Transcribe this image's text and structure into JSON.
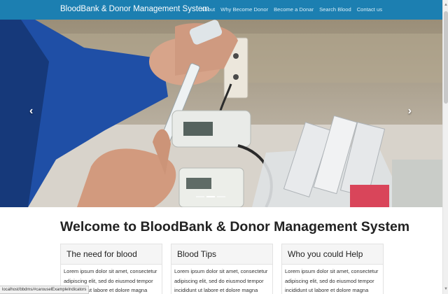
{
  "navbar": {
    "brand": "BloodBank & Donor Management System",
    "links": [
      "About",
      "Why Become Donor",
      "Become a Donar",
      "Search Blood",
      "Contact us"
    ]
  },
  "carousel": {
    "prev_icon": "chevron-left",
    "next_icon": "chevron-right",
    "slide_count": 3,
    "active_slide": 2
  },
  "main": {
    "welcome_title": "Welcome to BloodBank & Donor Management System",
    "cards": [
      {
        "title": "The need for blood",
        "text": "Lorem ipsum dolor sit amet, consectetur adipiscing elit, sed do eiusmod tempor incididunt ut labore et dolore magna aliqua."
      },
      {
        "title": "Blood Tips",
        "text": "Lorem ipsum dolor sit amet, consectetur adipiscing elit, sed do eiusmod tempor incididunt ut labore et dolore magna aliqua."
      },
      {
        "title": "Who you could Help",
        "text": "Lorem ipsum dolor sit amet, consectetur adipiscing elit, sed do eiusmod tempor incididunt ut labore et dolore magna aliqua."
      }
    ]
  },
  "status_bar": {
    "url": "localhost/bbdms/#carouselExampleIndicators"
  },
  "colors": {
    "navbar": "#1c7fb1",
    "card_header": "#f5f5f5",
    "title_text": "#222222"
  }
}
